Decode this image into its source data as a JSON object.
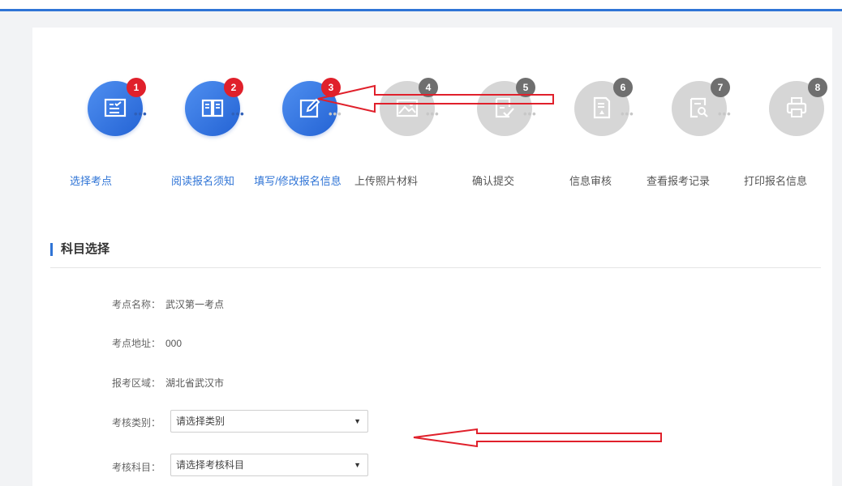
{
  "steps": [
    {
      "num": "1",
      "label": "选择考点",
      "icon": "checklist-icon",
      "active": true
    },
    {
      "num": "2",
      "label": "阅读报名须知",
      "icon": "book-icon",
      "active": true
    },
    {
      "num": "3",
      "label": "填写/修改报名信息",
      "icon": "edit-icon",
      "active": true
    },
    {
      "num": "4",
      "label": "上传照片材料",
      "icon": "image-icon",
      "active": false
    },
    {
      "num": "5",
      "label": "确认提交",
      "icon": "confirm-doc-icon",
      "active": false
    },
    {
      "num": "6",
      "label": "信息审核",
      "icon": "review-doc-icon",
      "active": false
    },
    {
      "num": "7",
      "label": "查看报考记录",
      "icon": "search-doc-icon",
      "active": false
    },
    {
      "num": "8",
      "label": "打印报名信息",
      "icon": "printer-icon",
      "active": false
    }
  ],
  "dots": "•••",
  "section": {
    "title": "科目选择"
  },
  "form": {
    "site_name_label": "考点名称：",
    "site_name_value": "武汉第一考点",
    "site_address_label": "考点地址：",
    "site_address_value": "000",
    "region_label": "报考区域：",
    "region_value": "湖北省武汉市",
    "category_label": "考核类别：",
    "category_placeholder": "请选择类别",
    "subject_label": "考核科目：",
    "subject_placeholder": "请选择考核科目"
  },
  "colors": {
    "accent": "#2f74d6",
    "badge_active": "#e0202b",
    "inactive": "#d6d6d6",
    "annotation_arrow": "#e0202b"
  }
}
